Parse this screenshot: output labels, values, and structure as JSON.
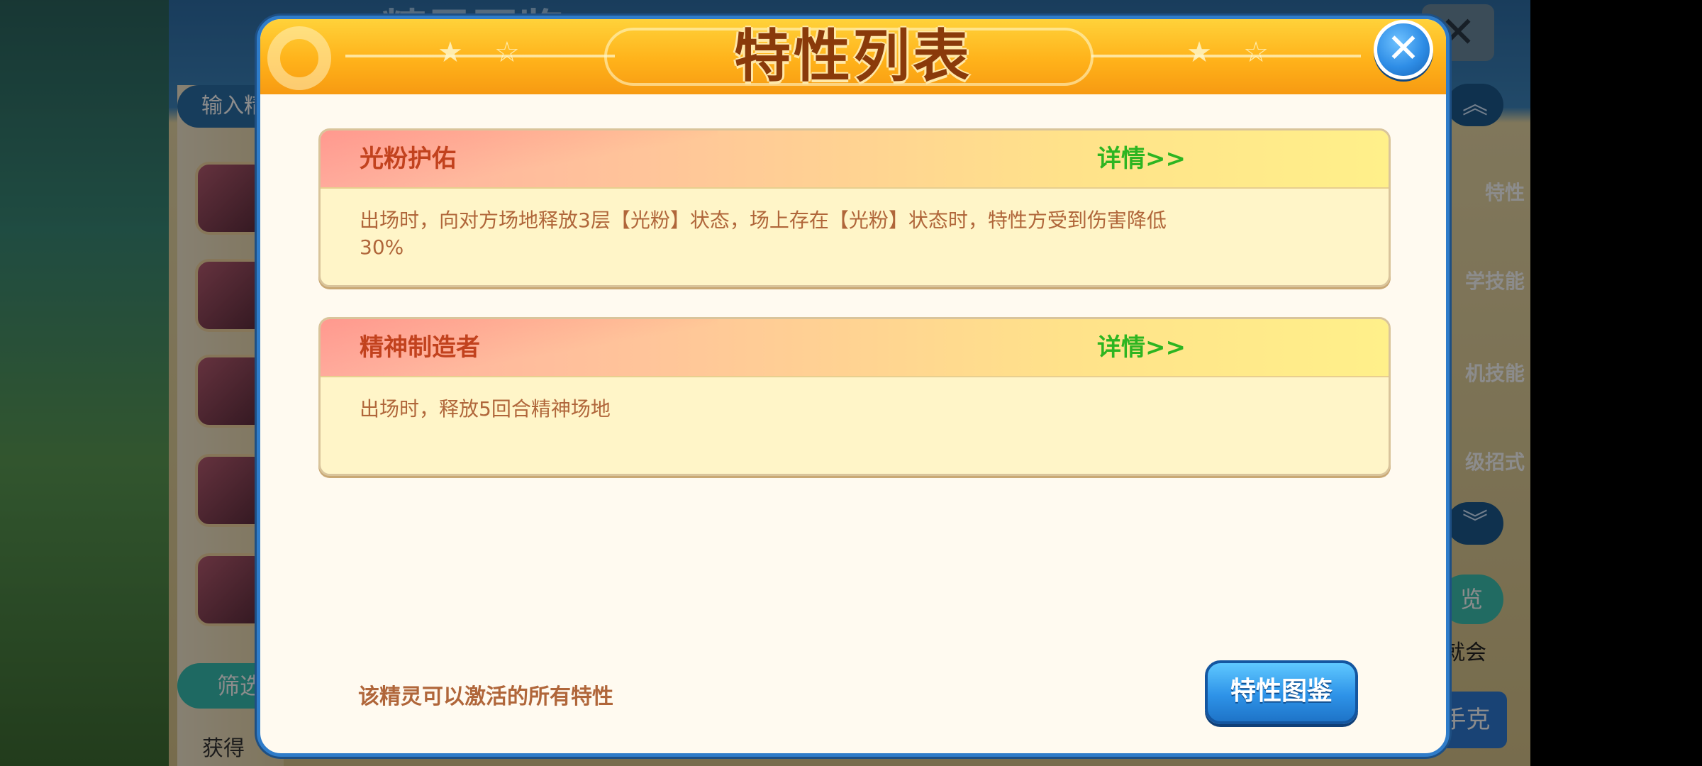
{
  "background": {
    "panel_title": "精灵图鉴",
    "search_placeholder": "输入精",
    "filter_label": "筛选",
    "bottom_hint": "获得",
    "right_tabs": [
      "特性",
      "学技能",
      "机技能",
      "级招式"
    ],
    "overview_label": "览",
    "side_text": "就会",
    "bottom_button": "手克"
  },
  "modal": {
    "title": "特性列表",
    "close_icon": "close-icon",
    "traits": [
      {
        "name": "光粉护佑",
        "detail_link": "详情>>",
        "description": "出场时，向对方场地释放3层【光粉】状态，场上存在【光粉】状态时，特性方受到伤害降低30%"
      },
      {
        "name": "精神制造者",
        "detail_link": "详情>>",
        "description": "出场时，释放5回合精神场地"
      }
    ],
    "footer_hint": "该精灵可以激活的所有特性",
    "codex_button": "特性图鉴"
  },
  "colors": {
    "header_orange": "#ffb21a",
    "trait_name": "#c2421e",
    "detail_link": "#2db521",
    "description": "#b0663a",
    "button_blue": "#2e93e8"
  }
}
